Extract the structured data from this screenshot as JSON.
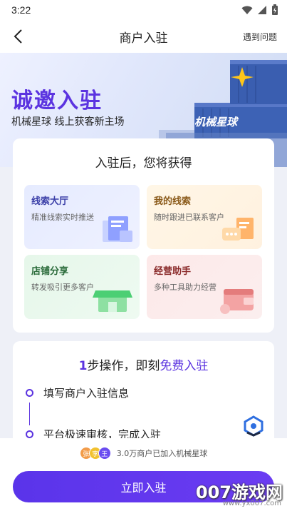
{
  "status": {
    "time": "3:22"
  },
  "nav": {
    "title": "商户入驻",
    "help": "遇到问题"
  },
  "banner": {
    "title": "诚邀入驻",
    "subtitle": "机械星球 线上获客新主场",
    "container_text": "机械星球"
  },
  "benefits": {
    "title": "入驻后，您将获得",
    "tiles": [
      {
        "title": "线索大厅",
        "subtitle": "精准线索实时推送",
        "icon": "document-cards-icon"
      },
      {
        "title": "我的线索",
        "subtitle": "随时跟进已联系客户",
        "icon": "message-card-icon"
      },
      {
        "title": "店铺分享",
        "subtitle": "转发吸引更多客户",
        "icon": "storefront-icon"
      },
      {
        "title": "经营助手",
        "subtitle": "多种工具助力经营",
        "icon": "wallet-icon"
      }
    ]
  },
  "steps": {
    "count": "1",
    "title_mid": "步操作，即刻",
    "title_free": "免费入驻",
    "items": [
      "填写商户入驻信息",
      "平台极速审核，完成入驻"
    ]
  },
  "bottom": {
    "avatars": [
      "张",
      "李",
      "王"
    ],
    "joined_text": "3.0万商户已加入机械星球",
    "cta_label": "立即入驻"
  },
  "watermark": {
    "text": "007游戏网",
    "url": "www.yx007.com"
  },
  "colors": {
    "accent": "#5b33e0"
  }
}
